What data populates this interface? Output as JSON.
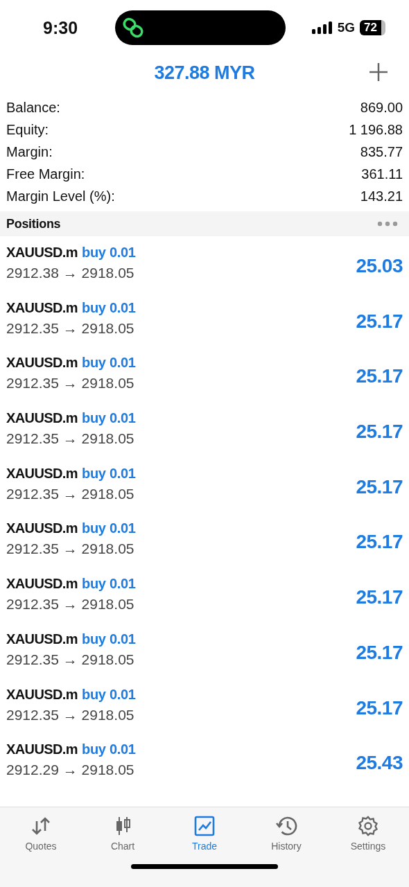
{
  "status_bar": {
    "time": "9:30",
    "network": "5G",
    "battery": "72"
  },
  "header": {
    "title": "327.88 MYR"
  },
  "summary": [
    {
      "label": "Balance:",
      "value": "869.00"
    },
    {
      "label": "Equity:",
      "value": "1 196.88"
    },
    {
      "label": "Margin:",
      "value": "835.77"
    },
    {
      "label": "Free Margin:",
      "value": "361.11"
    },
    {
      "label": "Margin Level (%):",
      "value": "143.21"
    }
  ],
  "positions": {
    "title": "Positions",
    "rows": [
      {
        "symbol": "XAUUSD.m",
        "order": "buy 0.01",
        "prices": "2912.38 → 2918.05",
        "profit": "25.03"
      },
      {
        "symbol": "XAUUSD.m",
        "order": "buy 0.01",
        "prices": "2912.35 → 2918.05",
        "profit": "25.17"
      },
      {
        "symbol": "XAUUSD.m",
        "order": "buy 0.01",
        "prices": "2912.35 → 2918.05",
        "profit": "25.17"
      },
      {
        "symbol": "XAUUSD.m",
        "order": "buy 0.01",
        "prices": "2912.35 → 2918.05",
        "profit": "25.17"
      },
      {
        "symbol": "XAUUSD.m",
        "order": "buy 0.01",
        "prices": "2912.35 → 2918.05",
        "profit": "25.17"
      },
      {
        "symbol": "XAUUSD.m",
        "order": "buy 0.01",
        "prices": "2912.35 → 2918.05",
        "profit": "25.17"
      },
      {
        "symbol": "XAUUSD.m",
        "order": "buy 0.01",
        "prices": "2912.35 → 2918.05",
        "profit": "25.17"
      },
      {
        "symbol": "XAUUSD.m",
        "order": "buy 0.01",
        "prices": "2912.35 → 2918.05",
        "profit": "25.17"
      },
      {
        "symbol": "XAUUSD.m",
        "order": "buy 0.01",
        "prices": "2912.35 → 2918.05",
        "profit": "25.17"
      },
      {
        "symbol": "XAUUSD.m",
        "order": "buy 0.01",
        "prices": "2912.29 → 2918.05",
        "profit": "25.43"
      }
    ]
  },
  "tabs": [
    {
      "label": "Quotes",
      "kind": "quotes",
      "selected": false
    },
    {
      "label": "Chart",
      "kind": "chart",
      "selected": false
    },
    {
      "label": "Trade",
      "kind": "trade",
      "selected": true
    },
    {
      "label": "History",
      "kind": "history",
      "selected": false
    },
    {
      "label": "Settings",
      "kind": "settings",
      "selected": false
    }
  ]
}
